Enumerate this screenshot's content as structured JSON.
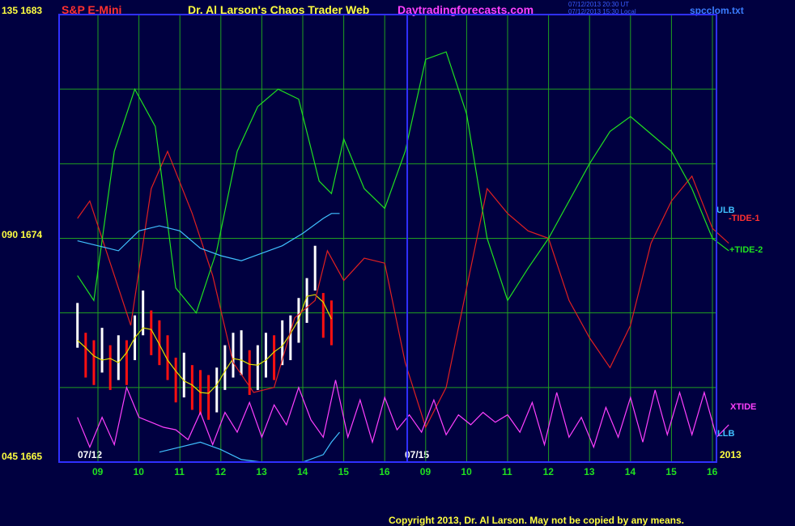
{
  "header": {
    "symbol": "S&P E-Mini",
    "title": "Dr. Al Larson's Chaos Trader Web",
    "site": "Daytradingforecasts.com",
    "stamp1": "07/12/2013 20:30 UT",
    "stamp2": "07/12/2013 15:30 Local",
    "file": "spcclom.txt"
  },
  "footer": {
    "copyright": "Copyright 2013, Dr. Al Larson. May not be copied by any means."
  },
  "colors": {
    "background": "#000040",
    "grid": "#20a020",
    "frame": "#3030ff",
    "tide1": "#e02020",
    "tide2": "#20e020",
    "xtide": "#ff40ff",
    "band": "#40c0ff",
    "price_up": "#ffffff",
    "price_down": "#ff1010",
    "avg": "#e0e000"
  },
  "chart_data": {
    "type": "line",
    "title": "S&P E-Mini",
    "y_labels": [
      {
        "text": "135 1683",
        "value": 1683
      },
      {
        "text": "090 1674",
        "value": 1674
      },
      {
        "text": "045 1665",
        "value": 1665
      }
    ],
    "ylim": [
      1665,
      1683
    ],
    "x_ticks": [
      "09",
      "10",
      "11",
      "12",
      "13",
      "14",
      "15",
      "16",
      "09",
      "10",
      "11",
      "12",
      "13",
      "14",
      "15",
      "16"
    ],
    "date_labels": [
      "07/12",
      "07/15",
      "2013"
    ],
    "legend": [
      "ULB",
      "-TIDE-1",
      "+TIDE-2",
      "XTIDE",
      "LLB"
    ],
    "series": [
      {
        "name": "-TIDE-1",
        "x": [
          0,
          0.3,
          0.8,
          1.3,
          1.8,
          2.2,
          2.8,
          3.3,
          3.8,
          4.3,
          4.8,
          5.3,
          5.8,
          6.1,
          6.5,
          7.0,
          7.5,
          8.0,
          8.5,
          9.0,
          9.5,
          10.0,
          10.5,
          11.0,
          11.5,
          12.0,
          12.5,
          13.0,
          13.5,
          14.0,
          14.5,
          15.0,
          15.5,
          15.9
        ],
        "values": [
          1674.8,
          1675.5,
          1673.0,
          1670.5,
          1676.0,
          1677.5,
          1675.0,
          1672.5,
          1669.0,
          1667.8,
          1668.0,
          1670.8,
          1671.5,
          1673.5,
          1672.3,
          1673.2,
          1673.0,
          1669.0,
          1666.4,
          1668.0,
          1672.0,
          1676.0,
          1675.0,
          1674.3,
          1674.0,
          1671.5,
          1670.0,
          1668.8,
          1670.5,
          1673.8,
          1675.5,
          1676.5,
          1674.4,
          1673.8
        ],
        "color": "#e02020"
      },
      {
        "name": "+TIDE-2",
        "x": [
          0,
          0.4,
          0.9,
          1.4,
          1.9,
          2.4,
          2.9,
          3.4,
          3.9,
          4.4,
          4.9,
          5.4,
          5.9,
          6.2,
          6.5,
          7.0,
          7.5,
          8.0,
          8.5,
          9.0,
          9.5,
          10.0,
          10.5,
          11.0,
          11.5,
          12.0,
          12.5,
          13.0,
          13.5,
          14.0,
          14.5,
          15.0,
          15.5,
          15.9
        ],
        "values": [
          1672.5,
          1671.5,
          1677.5,
          1680.0,
          1678.5,
          1672.0,
          1671.0,
          1673.5,
          1677.5,
          1679.3,
          1680.0,
          1679.6,
          1676.3,
          1675.8,
          1678.0,
          1676.0,
          1675.2,
          1677.5,
          1681.2,
          1681.5,
          1679.0,
          1674.0,
          1671.5,
          1672.8,
          1674.0,
          1675.5,
          1677.0,
          1678.3,
          1678.9,
          1678.2,
          1677.5,
          1676.0,
          1674.0,
          1673.5
        ],
        "color": "#20e020"
      },
      {
        "name": "ULB",
        "x": [
          0,
          0.5,
          1.0,
          1.5,
          2.0,
          2.5,
          3.0,
          3.5,
          4.0,
          4.5,
          5.0,
          5.5,
          6.0,
          6.2,
          6.4
        ],
        "values": [
          1673.9,
          1673.7,
          1673.5,
          1674.3,
          1674.5,
          1674.3,
          1673.6,
          1673.3,
          1673.1,
          1673.4,
          1673.7,
          1674.2,
          1674.8,
          1675.0,
          1675.0
        ],
        "color": "#40c0ff"
      },
      {
        "name": "LLB",
        "x": [
          2.0,
          2.5,
          3.0,
          3.5,
          4.0,
          4.5,
          5.0,
          5.5,
          6.0,
          6.2,
          6.4
        ],
        "values": [
          1665.4,
          1665.6,
          1665.8,
          1665.5,
          1665.1,
          1665.0,
          1665.0,
          1665.0,
          1665.3,
          1665.8,
          1666.2
        ],
        "color": "#40c0ff"
      },
      {
        "name": "XTIDE",
        "x": [
          0,
          0.3,
          0.6,
          0.9,
          1.2,
          1.5,
          1.8,
          2.1,
          2.4,
          2.7,
          3.0,
          3.3,
          3.6,
          3.9,
          4.2,
          4.5,
          4.8,
          5.1,
          5.4,
          5.7,
          6.0,
          6.3,
          6.6,
          6.9,
          7.2,
          7.5,
          7.8,
          8.1,
          8.4,
          8.7,
          9.0,
          9.3,
          9.6,
          9.9,
          10.2,
          10.5,
          10.8,
          11.1,
          11.4,
          11.7,
          12.0,
          12.3,
          12.6,
          12.9,
          13.2,
          13.5,
          13.8,
          14.1,
          14.4,
          14.7,
          15.0,
          15.3,
          15.6,
          15.9
        ],
        "values": [
          1666.8,
          1665.6,
          1666.8,
          1665.7,
          1668.0,
          1666.8,
          1666.6,
          1666.4,
          1666.3,
          1665.9,
          1667.0,
          1665.7,
          1667.0,
          1666.2,
          1667.4,
          1666.0,
          1667.3,
          1666.5,
          1668.0,
          1666.7,
          1666.0,
          1668.3,
          1666.0,
          1667.5,
          1665.8,
          1667.6,
          1666.3,
          1666.9,
          1666.2,
          1667.5,
          1666.1,
          1666.9,
          1666.5,
          1667.0,
          1666.6,
          1666.9,
          1666.2,
          1667.4,
          1665.7,
          1667.8,
          1666.0,
          1666.8,
          1665.6,
          1667.2,
          1666.0,
          1667.6,
          1665.8,
          1667.9,
          1666.1,
          1667.8,
          1666.1,
          1667.8,
          1666.0,
          1666.5
        ],
        "color": "#ff40ff"
      },
      {
        "name": "price",
        "x": [
          0,
          0.2,
          0.4,
          0.6,
          0.8,
          1.0,
          1.2,
          1.4,
          1.6,
          1.8,
          2.0,
          2.2,
          2.4,
          2.6,
          2.8,
          3.0,
          3.2,
          3.4,
          3.6,
          3.8,
          4.0,
          4.2,
          4.4,
          4.6,
          4.8,
          5.0,
          5.2,
          5.4,
          5.6,
          5.8,
          6.0,
          6.2
        ],
        "values": [
          1670.5,
          1669.3,
          1669.0,
          1669.5,
          1668.8,
          1669.2,
          1669.0,
          1670.0,
          1671.0,
          1670.2,
          1669.8,
          1669.2,
          1668.3,
          1668.5,
          1668.0,
          1667.8,
          1667.6,
          1667.9,
          1668.8,
          1669.3,
          1669.4,
          1668.6,
          1668.8,
          1669.3,
          1669.2,
          1669.8,
          1670.0,
          1670.7,
          1671.5,
          1672.8,
          1670.9,
          1670.6
        ],
        "color": "#ffffff"
      }
    ]
  }
}
